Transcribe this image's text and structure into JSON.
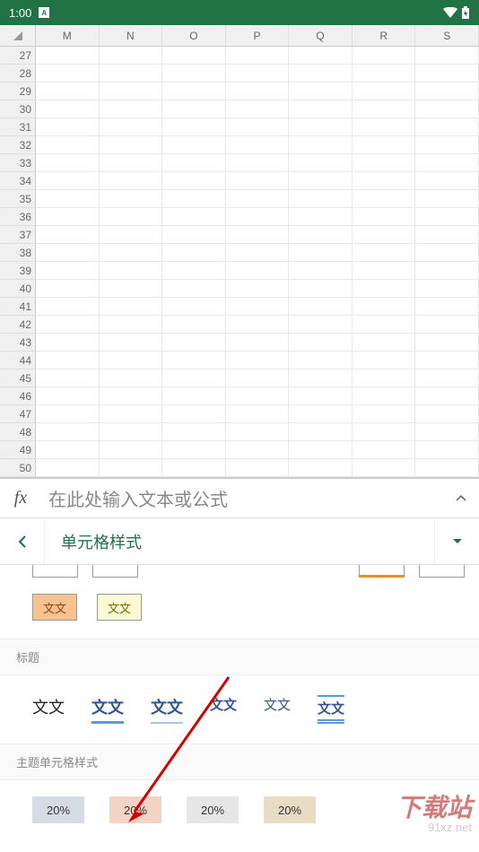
{
  "status": {
    "time": "1:00",
    "icon_a": "A"
  },
  "columns": [
    "M",
    "N",
    "O",
    "P",
    "Q",
    "R",
    "S"
  ],
  "rows": [
    27,
    28,
    29,
    30,
    31,
    32,
    33,
    34,
    35,
    36,
    37,
    38,
    39,
    40,
    41,
    42,
    43,
    44,
    45,
    46,
    47,
    48,
    49,
    50
  ],
  "formula": {
    "fx": "fx",
    "placeholder": "在此处输入文本或公式"
  },
  "panel": {
    "title": "单元格样式"
  },
  "section_titles": {
    "heading": "标题",
    "theme": "主题单元格样式"
  },
  "style_samples": {
    "text": "文文"
  },
  "title_styles": [
    "文文",
    "文文",
    "文文",
    "文文",
    "文文",
    "文文"
  ],
  "theme_styles": [
    "20%",
    "20%",
    "20%",
    "20%"
  ],
  "watermark": {
    "main": "下载站",
    "sub": "91xz.net"
  }
}
